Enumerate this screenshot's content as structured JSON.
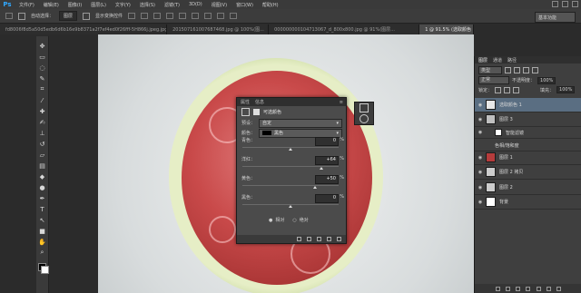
{
  "app": {
    "logo": "Ps"
  },
  "menubar": {
    "items": [
      "文件(F)",
      "编辑(E)",
      "图像(I)",
      "图层(L)",
      "文字(Y)",
      "选择(S)",
      "滤镜(T)",
      "3D(D)",
      "视图(V)",
      "窗口(W)",
      "帮助(H)"
    ]
  },
  "options": {
    "auto_select_label": "自动选择：",
    "auto_select_value": "图层",
    "transform_label": "显示变换控件",
    "workspace": "基本功能"
  },
  "tabs": [
    {
      "label": "fd8006f8d5a50d5edb6d6b16e9b8371a2f7ef4ed0f26fff-5H866j.jpeg.jpg @ 100...",
      "active": false
    },
    {
      "label": "201507161007687468.jpg @ 100%(图...",
      "active": false
    },
    {
      "label": "000000000104713067_d_800x800.jpg @ 91%(图层...",
      "active": false
    },
    {
      "label": "1 @ 91.5% (选取颜色 1, RGB/8#)",
      "active": true
    }
  ],
  "tools": [
    "move-icon",
    "marquee-icon",
    "lasso-icon",
    "quick-select-icon",
    "crop-icon",
    "eyedropper-icon",
    "healing-icon",
    "brush-icon",
    "stamp-icon",
    "history-brush-icon",
    "eraser-icon",
    "gradient-icon",
    "blur-icon",
    "dodge-icon",
    "pen-icon",
    "type-icon",
    "path-select-icon",
    "shape-icon",
    "hand-icon",
    "zoom-icon"
  ],
  "properties": {
    "tab_properties": "属性",
    "tab_info": "信息",
    "title": "可选颜色",
    "preset_label": "预设：",
    "preset_value": "自定",
    "color_label": "颜色：",
    "color_value": "黑色",
    "sliders": [
      {
        "label": "青色：",
        "value": "0",
        "unit": "%",
        "position": 0.5
      },
      {
        "label": "洋红：",
        "value": "+64",
        "unit": "%",
        "position": 0.82
      },
      {
        "label": "黄色：",
        "value": "+50",
        "unit": "%",
        "position": 0.75
      },
      {
        "label": "黑色：",
        "value": "0",
        "unit": "%",
        "position": 0.5
      }
    ],
    "method_relative": "相对",
    "method_absolute": "绝对"
  },
  "layers": {
    "tabs": [
      "图层",
      "通道",
      "路径"
    ],
    "kind_label": "类型",
    "blend_mode": "正常",
    "opacity_label": "不透明度：",
    "opacity_value": "100%",
    "lock_label": "锁定：",
    "fill_label": "填充：",
    "fill_value": "100%",
    "items": [
      {
        "name": "选取颜色 1",
        "selected": true,
        "thumb": "#e8e8e8"
      },
      {
        "name": "图层 3",
        "selected": false,
        "thumb": "#bfbfbf"
      },
      {
        "name": "智能滤镜",
        "selected": false,
        "thumb": "#ffffff"
      },
      {
        "name": "色相/饱和度",
        "selected": false,
        "thumb": ""
      },
      {
        "name": "图层 1",
        "selected": false,
        "thumb": "#b53c3c"
      },
      {
        "name": "图层 2 拷贝",
        "selected": false,
        "thumb": "#cccccc"
      },
      {
        "name": "图层 2",
        "selected": false,
        "thumb": "#cccccc"
      },
      {
        "name": "背景",
        "selected": false,
        "thumb": "#ffffff"
      }
    ]
  },
  "colors": {
    "accent": "#31a8ff",
    "selected_row": "#5a6e82"
  }
}
